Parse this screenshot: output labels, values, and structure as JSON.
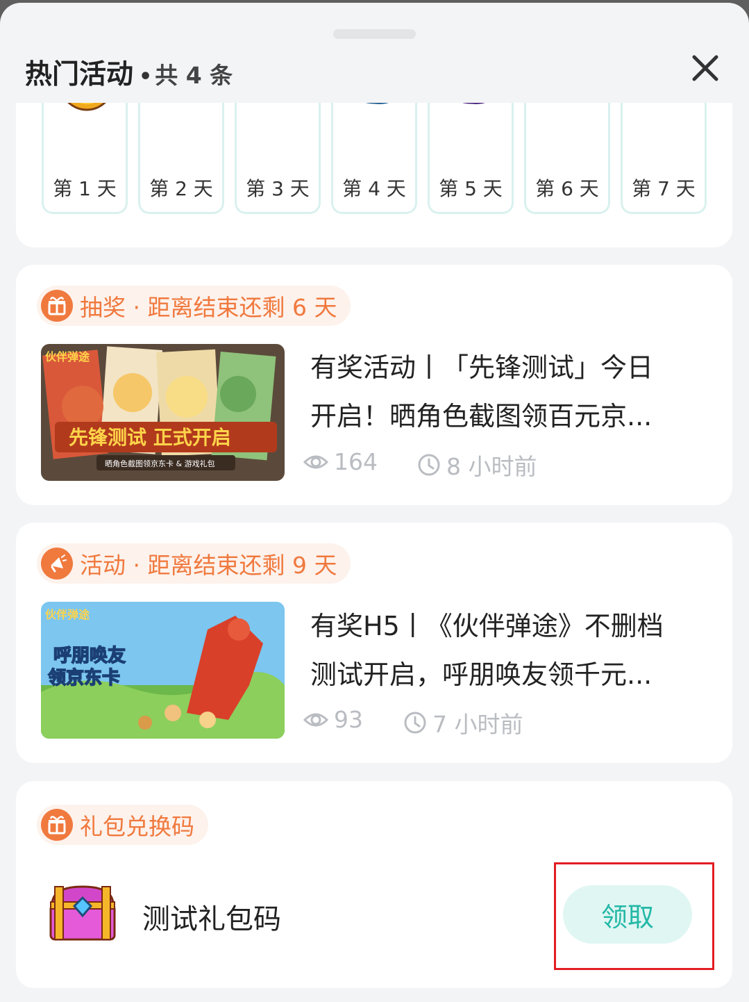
{
  "panel": {
    "title": "热门活动",
    "separator": "•",
    "count_label": "共 4 条"
  },
  "days": [
    {
      "label": "第 1 天",
      "icon": "gold-coin-icon"
    },
    {
      "label": "第 2 天",
      "icon": "blue-cube-icon"
    },
    {
      "label": "第 3 天",
      "icon": "yellow-ticket-icon"
    },
    {
      "label": "第 4 天",
      "icon": "blue-gem-icon"
    },
    {
      "label": "第 5 天",
      "icon": "purple-gem-icon"
    },
    {
      "label": "第 6 天",
      "icon": "red-gem-icon"
    },
    {
      "label": "第 7 天",
      "icon": "orange-card-icon"
    }
  ],
  "activities": [
    {
      "tag": "抽奖 · 距离结束还剩 6 天",
      "tag_icon": "gift-icon",
      "title_line1": "有奖活动丨「先锋测试」今日",
      "title_line2": "开启！晒角色截图领百元京...",
      "views": "164",
      "time": "8 小时前",
      "thumb_logo": "伙伴弹途",
      "thumb_banner": "先锋测试 正式开启",
      "thumb_caption": "晒角色截图领京东卡 & 游戏礼包"
    },
    {
      "tag": "活动 · 距离结束还剩 9 天",
      "tag_icon": "megaphone-icon",
      "title_line1": "有奖H5丨《伙伴弹途》不删档",
      "title_line2": "测试开启，呼朋唤友领千元...",
      "views": "93",
      "time": "7 小时前",
      "thumb_logo": "伙伴弹途",
      "thumb_banner_line1": "呼朋唤友",
      "thumb_banner_line2": "领京东卡"
    }
  ],
  "gift_section": {
    "tag": "礼包兑换码",
    "tag_icon": "gift-icon",
    "item_name": "测试礼包码",
    "item_icon": "treasure-chest-icon",
    "button_label": "领取"
  },
  "colors": {
    "accent_orange": "#f0793e",
    "teal": "#23b8a6",
    "highlight": "#e21d24"
  }
}
